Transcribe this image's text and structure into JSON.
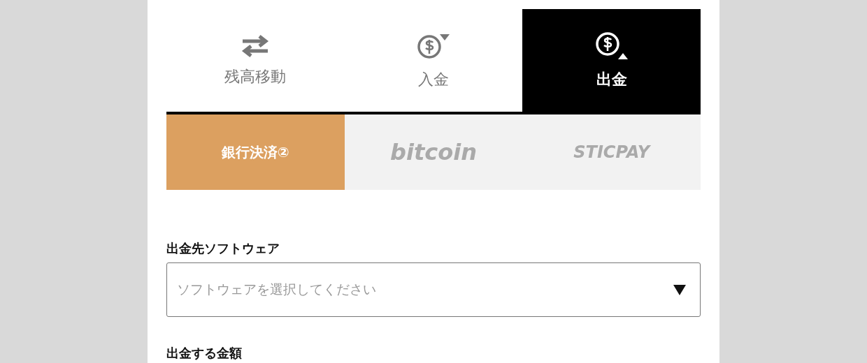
{
  "main_tabs": [
    {
      "label": "残高移動",
      "kind": "transfer",
      "selected": false
    },
    {
      "label": "入金",
      "kind": "deposit",
      "selected": false
    },
    {
      "label": "出金",
      "kind": "withdraw",
      "selected": true
    }
  ],
  "method_tabs": [
    {
      "label": "銀行決済②",
      "selected": true
    },
    {
      "label": "bitcoin",
      "selected": false
    },
    {
      "label": "STICPAY",
      "selected": false
    }
  ],
  "software_field": {
    "label": "出金先ソフトウェア",
    "placeholder": "ソフトウェアを選択してください"
  },
  "amount_field": {
    "label": "出金する金額"
  }
}
